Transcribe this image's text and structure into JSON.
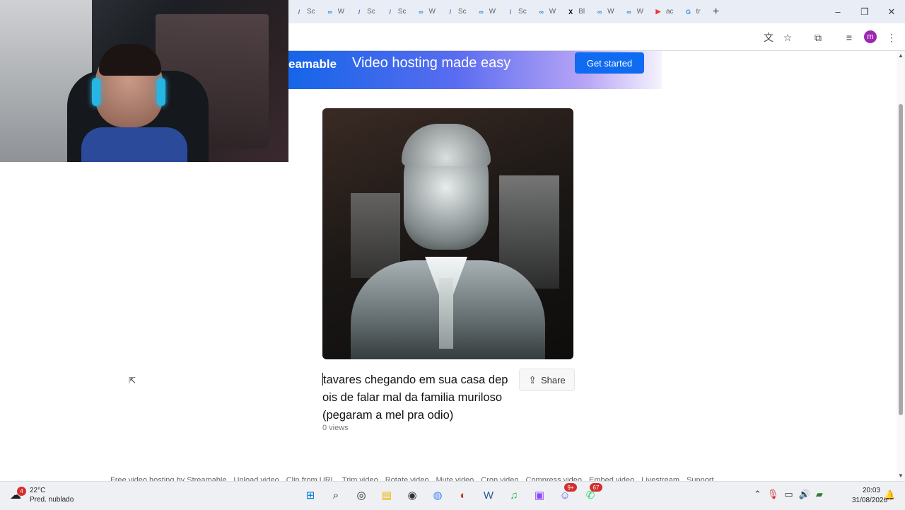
{
  "browser": {
    "tabs": [
      {
        "favicon": "stylus-icon",
        "label": "Sc",
        "color": "#7e57c2"
      },
      {
        "favicon": "whatsapp-web-icon",
        "label": "W",
        "color": "#1e88e5"
      },
      {
        "favicon": "stylus-icon",
        "label": "Sc",
        "color": "#7e57c2"
      },
      {
        "favicon": "stylus-icon",
        "label": "Sc",
        "color": "#7e57c2"
      },
      {
        "favicon": "whatsapp-web-icon",
        "label": "W",
        "color": "#1e88e5"
      },
      {
        "favicon": "stylus-icon",
        "label": "Sc",
        "color": "#7e57c2"
      },
      {
        "favicon": "whatsapp-web-icon",
        "label": "W",
        "color": "#1e88e5"
      },
      {
        "favicon": "stylus-icon",
        "label": "Sc",
        "color": "#7e57c2"
      },
      {
        "favicon": "whatsapp-web-icon",
        "label": "W",
        "color": "#1e88e5"
      },
      {
        "favicon": "x-icon",
        "label": "Bl",
        "color": "#000000"
      },
      {
        "favicon": "whatsapp-web-icon",
        "label": "W",
        "color": "#1e88e5"
      },
      {
        "favicon": "whatsapp-web-icon",
        "label": "W",
        "color": "#1e88e5"
      },
      {
        "favicon": "youtube-icon",
        "label": "ac",
        "color": "#e53935"
      },
      {
        "favicon": "google-icon",
        "label": "tr",
        "color": "#4285f4"
      }
    ],
    "new_tab": "+",
    "controls": {
      "minimize": "–",
      "restore": "❐",
      "close": "✕"
    },
    "profile_initial": "m"
  },
  "page": {
    "banner": {
      "brand": "eamable",
      "tagline": "Video hosting made easy",
      "cta": "Get started"
    },
    "video": {
      "title": "tavares chegando em sua casa depois de falar mal da familia muriloso (pegaram a mel pra odio)",
      "views": "0 views",
      "share_label": "Share"
    },
    "footer_links": [
      "Free video hosting by Streamable",
      "Upload video",
      "Clip from URL",
      "Trim video",
      "Rotate video",
      "Mute video",
      "Crop video",
      "Compress video",
      "Embed video",
      "Livestream",
      "Support"
    ]
  },
  "taskbar": {
    "weather": {
      "temp": "22°C",
      "condition": "Pred. nublado",
      "badge": "4"
    },
    "apps": [
      {
        "icon": "windows-start-icon",
        "badge": ""
      },
      {
        "icon": "search-icon",
        "badge": ""
      },
      {
        "icon": "steam-icon",
        "badge": ""
      },
      {
        "icon": "file-explorer-icon",
        "badge": ""
      },
      {
        "icon": "obs-icon",
        "badge": ""
      },
      {
        "icon": "chrome-icon",
        "badge": ""
      },
      {
        "icon": "davinci-icon",
        "badge": ""
      },
      {
        "icon": "wordpad-icon",
        "badge": ""
      },
      {
        "icon": "spotify-icon",
        "badge": ""
      },
      {
        "icon": "twitch-icon",
        "badge": ""
      },
      {
        "icon": "discord-icon",
        "badge": "9+"
      },
      {
        "icon": "whatsapp-icon",
        "badge": "67"
      }
    ],
    "time": "20:03",
    "date": "31/08/2026"
  }
}
